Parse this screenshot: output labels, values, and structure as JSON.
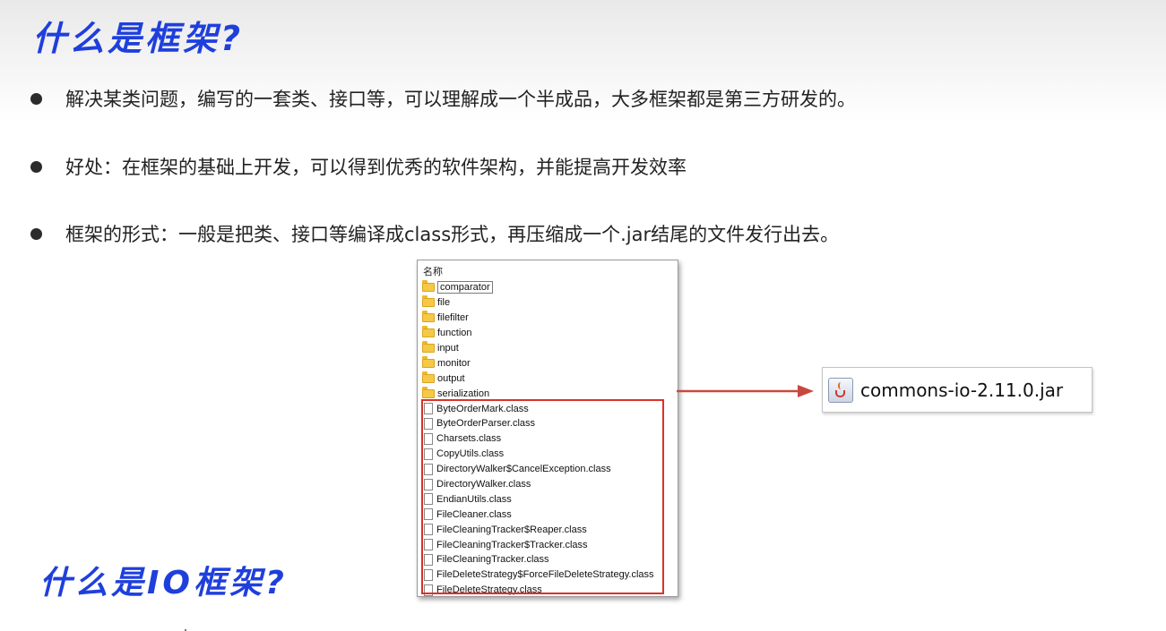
{
  "slide": {
    "title": "什么是框架?",
    "subtitle": "什么是IO框架?",
    "bullets": [
      "解决某类问题，编写的一套类、接口等，可以理解成一个半成品，大多框架都是第三方研发的。",
      "好处：在框架的基础上开发，可以得到优秀的软件架构，并能提高开发效率",
      "框架的形式：一般是把类、接口等编译成class形式，再压缩成一个.jar结尾的文件发行出去。"
    ]
  },
  "explorer": {
    "header": "名称",
    "folders": [
      "comparator",
      "file",
      "filefilter",
      "function",
      "input",
      "monitor",
      "output",
      "serialization"
    ],
    "files": [
      "ByteOrderMark.class",
      "ByteOrderParser.class",
      "Charsets.class",
      "CopyUtils.class",
      "DirectoryWalker$CancelException.class",
      "DirectoryWalker.class",
      "EndianUtils.class",
      "FileCleaner.class",
      "FileCleaningTracker$Reaper.class",
      "FileCleaningTracker$Tracker.class",
      "FileCleaningTracker.class",
      "FileDeleteStrategy$ForceFileDeleteStrategy.class",
      "FileDeleteStrategy.class"
    ]
  },
  "jar": {
    "label": "commons-io-2.11.0.jar",
    "icon": "java-jar-icon"
  },
  "colors": {
    "title": "#1f3fdc",
    "highlight": "#d8322c",
    "arrow": "#c8483f"
  }
}
